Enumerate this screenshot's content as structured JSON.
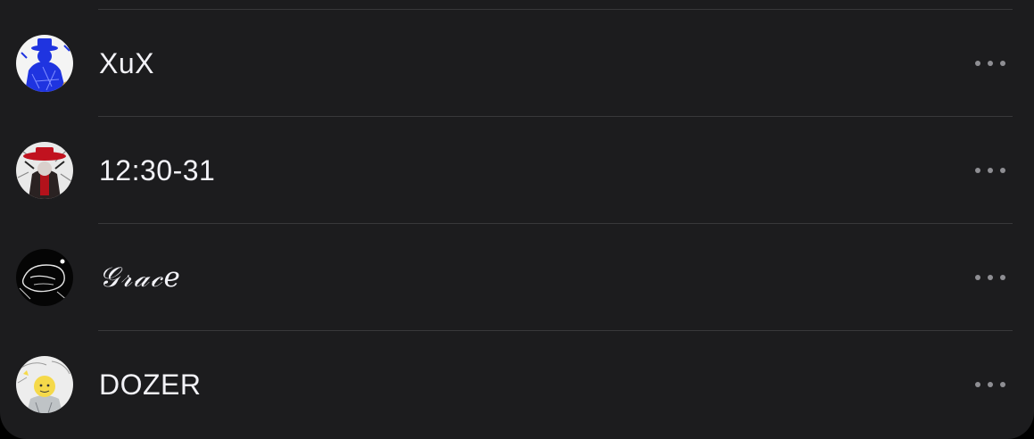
{
  "contacts": [
    {
      "name": "XuX",
      "avatar_icon": "blue-figure-avatar",
      "style": "normal"
    },
    {
      "name": "12:30-31",
      "avatar_icon": "red-hat-figure-avatar",
      "style": "normal"
    },
    {
      "name": "𝒢𝓇𝒶𝒸𝑒",
      "avatar_icon": "black-sketch-avatar",
      "style": "script"
    },
    {
      "name": "DOZER",
      "avatar_icon": "yellow-face-sketch-avatar",
      "style": "normal"
    }
  ],
  "more_icon": "more-horizontal-icon",
  "colors": {
    "background": "#000000",
    "panel": "#1c1c1e",
    "divider": "#38383a",
    "text": "#f2f2f7",
    "icon_gray": "#8e8e93"
  }
}
